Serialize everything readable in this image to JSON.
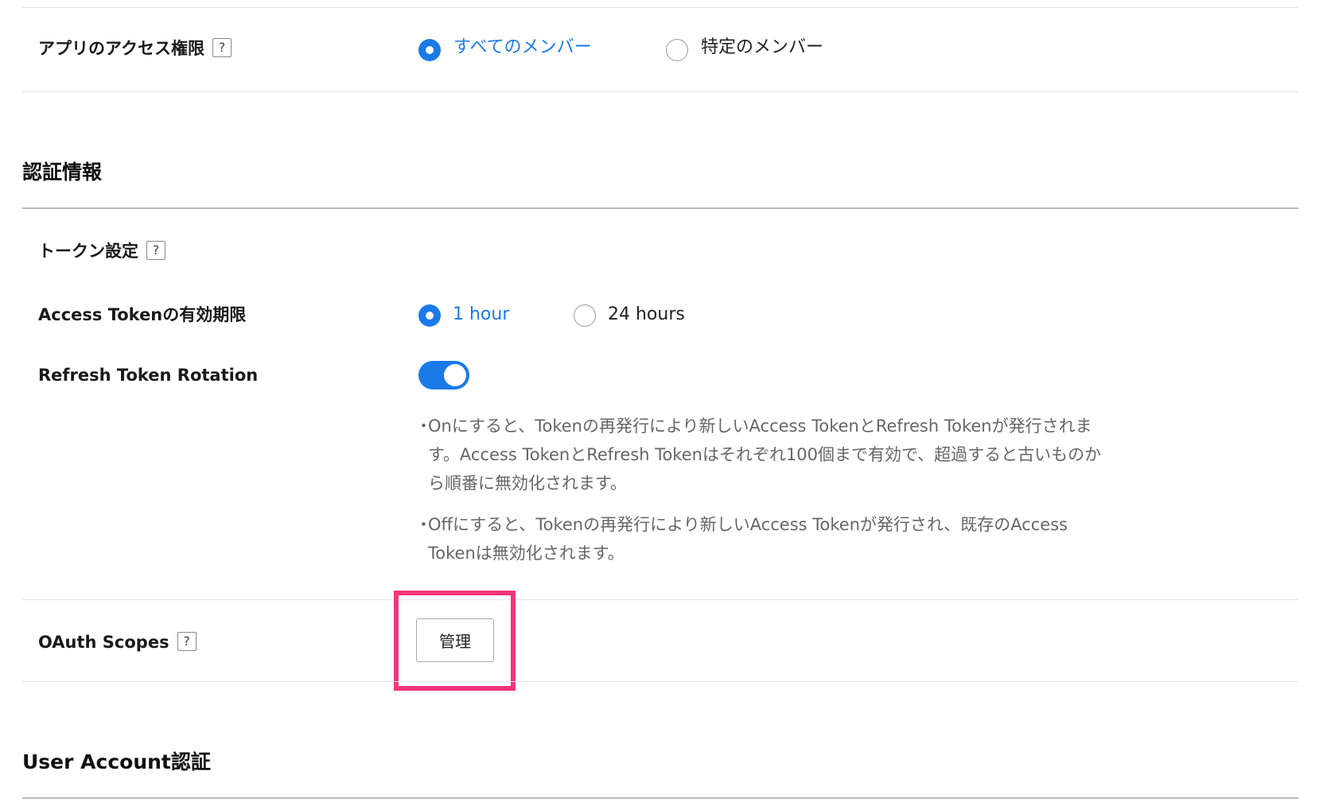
{
  "access": {
    "label": "アプリのアクセス権限",
    "help": "?",
    "options": [
      "すべてのメンバー",
      "特定のメンバー"
    ],
    "selected": "すべてのメンバー"
  },
  "auth_section": {
    "title": "認証情報"
  },
  "token_settings": {
    "label": "トークン設定",
    "help": "?"
  },
  "access_token": {
    "label": "Access Tokenの有効期限",
    "options": [
      "1 hour",
      "24 hours"
    ],
    "selected": "1 hour"
  },
  "refresh_rotation": {
    "label": "Refresh Token Rotation",
    "enabled": true,
    "notes": [
      {
        "bullet": "・",
        "lines": [
          "Onにすると、Tokenの再発行により新しいAccess TokenとRefresh Tokenが発行されま",
          "す。Access TokenとRefresh Tokenはそれぞれ100個まで有効で、超過すると古いものか",
          "ら順番に無効化されます。"
        ]
      },
      {
        "bullet": "・",
        "lines": [
          "Offにすると、Tokenの再発行により新しいAccess Tokenが発行され、既存のAccess",
          "Tokenは無効化されます。"
        ]
      }
    ]
  },
  "oauth_scopes": {
    "label": "OAuth Scopes",
    "help": "?",
    "button": "管理"
  },
  "user_account_section": {
    "title": "User Account認証"
  },
  "colors": {
    "accent": "#1a7ae8",
    "highlight": "#f5357a"
  }
}
